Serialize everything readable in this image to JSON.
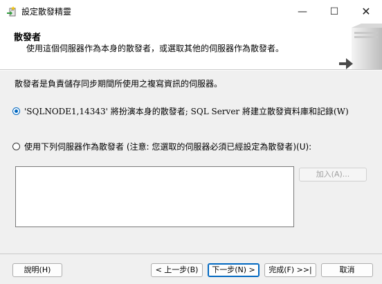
{
  "window": {
    "title": "設定散發精靈",
    "minimize_glyph": "—",
    "maximize_glyph": "☐",
    "close_glyph": "✕"
  },
  "header": {
    "title": "散發者",
    "description": "使用這個伺服器作為本身的散發者，或選取其他的伺服器作為散發者。"
  },
  "body": {
    "description": "散發者是負責儲存同步期間所使用之複寫資訊的伺服器。",
    "option_self": {
      "label": "'SQLNODE1,14343' 將扮演本身的散發者; SQL Server 將建立散發資料庫和記錄(W)",
      "checked": true
    },
    "option_other": {
      "label": "使用下列伺服器作為散發者 (注意: 您選取的伺服器必須已經設定為散發者)(U):",
      "checked": false
    },
    "add_button": "加入(A)..."
  },
  "footer": {
    "help": "說明(H)",
    "back": "< 上一步(B)",
    "next": "下一步(N) >",
    "finish": "完成(F) >>|",
    "cancel": "取消"
  },
  "colors": {
    "accent": "#0067c0",
    "background": "#f0f0f0"
  }
}
